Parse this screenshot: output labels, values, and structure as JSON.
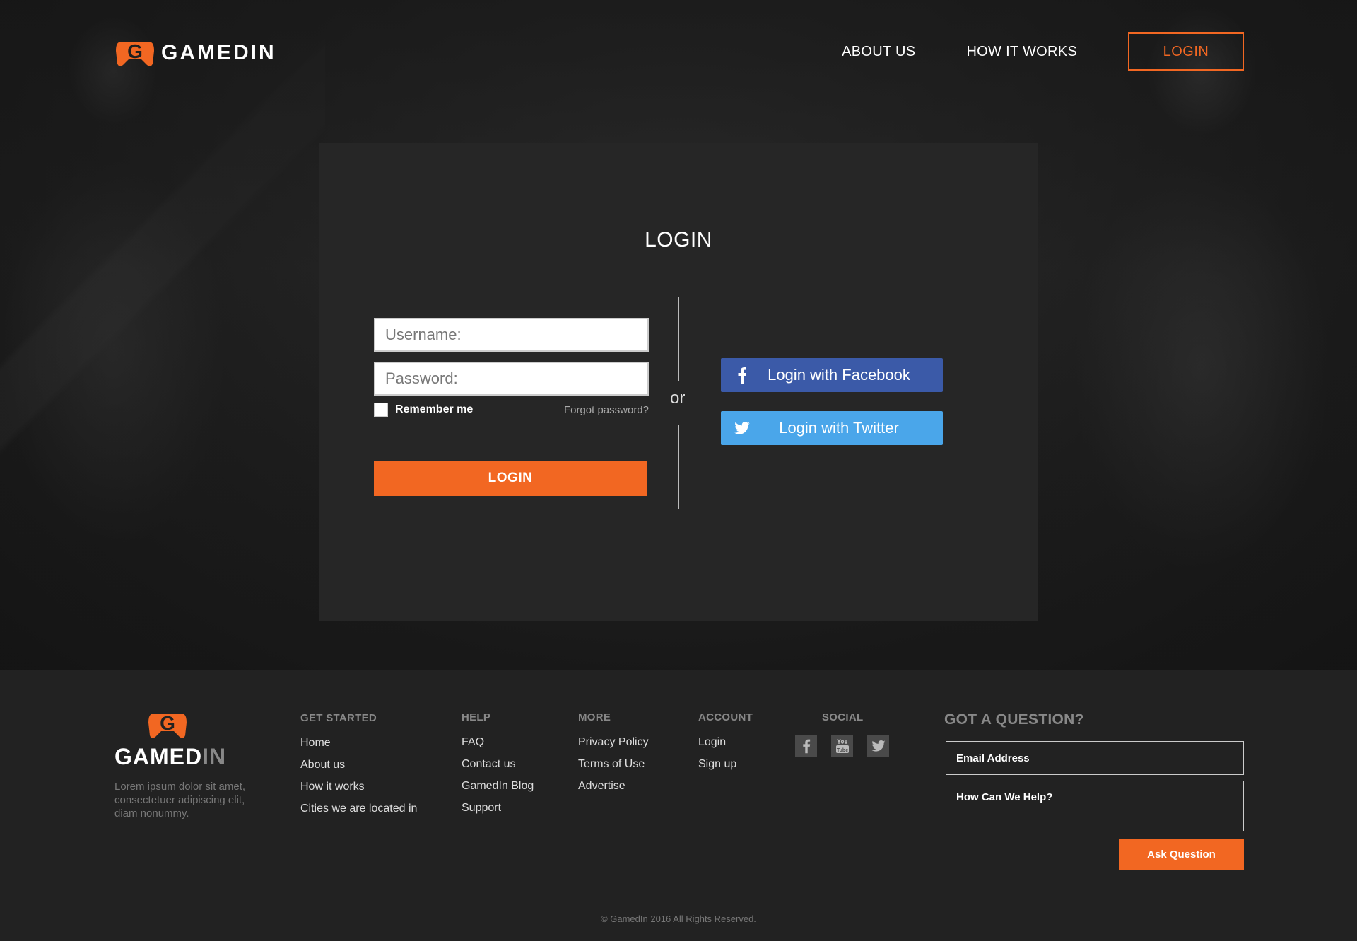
{
  "brand": {
    "name": "GAMEDIN",
    "footer_name_main": "GAMED",
    "footer_name_dim": "IN",
    "accent": "#f26722",
    "facebook": "#3b5aa8",
    "twitter": "#4aa6ea"
  },
  "nav": {
    "about": "ABOUT US",
    "how": "HOW IT WORKS",
    "login": "LOGIN"
  },
  "login_card": {
    "title": "LOGIN",
    "username_placeholder": "Username:",
    "password_placeholder": "Password:",
    "remember": "Remember me",
    "forgot": "Forgot password?",
    "submit": "LOGIN",
    "or": "or",
    "facebook": "Login with Facebook",
    "twitter": "Login with Twitter"
  },
  "footer": {
    "description": "Lorem ipsum dolor sit amet, consectetuer adipiscing elit, diam nonummy.",
    "columns": {
      "get_started": {
        "title": "GET STARTED",
        "links": [
          "Home",
          "About us",
          "How it works",
          "Cities we are located in"
        ]
      },
      "help": {
        "title": "HELP",
        "links": [
          "FAQ",
          "Contact us",
          "GamedIn Blog",
          "Support"
        ]
      },
      "more": {
        "title": "MORE",
        "links": [
          "Privacy Policy",
          "Terms of Use",
          "Advertise"
        ]
      },
      "account": {
        "title": "ACCOUNT",
        "links": [
          "Login",
          "Sign up"
        ]
      },
      "social": {
        "title": "SOCIAL",
        "icons": [
          "facebook-icon",
          "youtube-icon",
          "twitter-icon"
        ]
      }
    },
    "question": {
      "title": "GOT A QUESTION?",
      "email": "Email Address",
      "message": "How Can We Help?",
      "submit": "Ask Question"
    },
    "copyright": "© GamedIn 2016 All Rights Reserved."
  }
}
